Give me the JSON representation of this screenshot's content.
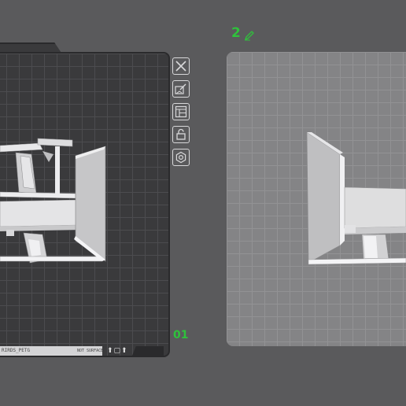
{
  "left_view": {
    "label": "01",
    "status_text": "RIRDS_PETG",
    "status_subtext": "NOT SURFACE",
    "status_icons": "⬆▢⬆"
  },
  "right_view": {
    "label": "2"
  },
  "toolbar": {
    "buttons": [
      {
        "name": "close",
        "icon": "close-icon"
      },
      {
        "name": "edit",
        "icon": "edit-icon"
      },
      {
        "name": "layout",
        "icon": "layout-icon"
      },
      {
        "name": "lock",
        "icon": "lock-icon"
      },
      {
        "name": "settings",
        "icon": "gear-icon"
      }
    ]
  },
  "colors": {
    "accent_green": "#2fc23c",
    "background": "#5a5a5c",
    "dark_plate": "#3a3a3c",
    "light_plate": "#848486"
  }
}
